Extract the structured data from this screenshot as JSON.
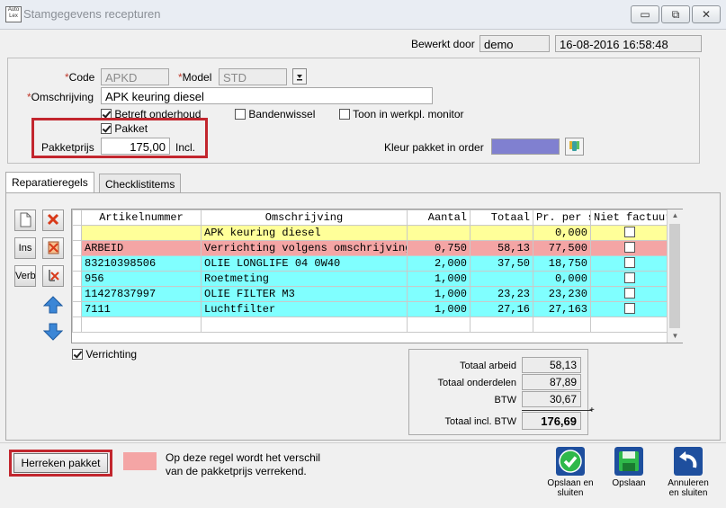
{
  "window": {
    "title": "Stamgegevens recepturen",
    "icon_text": "Auto Lex",
    "min_label": "▭",
    "restore_label": "⧉",
    "close_label": "✕"
  },
  "header": {
    "edited_by_label": "Bewerkt door",
    "edited_by_value": "demo",
    "edited_datetime": "16-08-2016 16:58:48"
  },
  "form": {
    "code_label": "Code",
    "code_value": "APKD",
    "model_label": "Model",
    "model_value": "STD",
    "description_label": "Omschrijving",
    "description_value": "APK keuring diesel",
    "betreft_onderhoud_label": "Betreft onderhoud",
    "bandenwissel_label": "Bandenwissel",
    "toon_monitor_label": "Toon in werkpl. monitor",
    "pakket_label": "Pakket",
    "pakketprijs_label": "Pakketprijs",
    "pakketprijs_value": "175,00",
    "incl_label": "Incl.",
    "kleur_label": "Kleur pakket in order",
    "kleur_color": "#8080d0"
  },
  "tabs": [
    {
      "label": "Reparatieregels"
    },
    {
      "label": "Checklistitems"
    }
  ],
  "side_buttons": {
    "ins_label": "Ins",
    "verb_label": "Verb"
  },
  "grid": {
    "columns": [
      "Artikelnummer",
      "Omschrijving",
      "Aantal",
      "Totaal",
      "Pr. per s",
      "Niet factuur"
    ],
    "rows": [
      {
        "art": "",
        "desc": "APK keuring diesel",
        "qty": "",
        "total": "",
        "price": "0,000",
        "color": "#ffff99"
      },
      {
        "art": "ARBEID",
        "desc": "Verrichting volgens omschrijving",
        "qty": "0,750",
        "total": "58,13",
        "price": "77,500",
        "color": "#f4a5a5"
      },
      {
        "art": "83210398506",
        "desc": "OLIE LONGLIFE 04 0W40",
        "qty": "2,000",
        "total": "37,50",
        "price": "18,750",
        "color": "#80ffff"
      },
      {
        "art": "956",
        "desc": "Roetmeting",
        "qty": "1,000",
        "total": "",
        "price": "0,000",
        "color": "#80ffff"
      },
      {
        "art": "11427837997",
        "desc": "OLIE FILTER M3",
        "qty": "1,000",
        "total": "23,23",
        "price": "23,230",
        "color": "#80ffff"
      },
      {
        "art": "7111",
        "desc": "Luchtfilter",
        "qty": "1,000",
        "total": "27,16",
        "price": "27,163",
        "color": "#80ffff"
      }
    ]
  },
  "verrichting_label": "Verrichting",
  "totals": {
    "arbeid_label": "Totaal arbeid",
    "arbeid_value": "58,13",
    "onderdelen_label": "Totaal onderdelen",
    "onderdelen_value": "87,89",
    "btw_label": "BTW",
    "btw_value": "30,67",
    "incl_label": "Totaal incl. BTW",
    "incl_value": "176,69"
  },
  "footer": {
    "herreken_label": "Herreken pakket",
    "legend_text_1": "Op deze regel wordt het verschil",
    "legend_text_2": "van de pakketprijs verrekend.",
    "legend_color": "#f4a5a5",
    "save_close_label_1": "Opslaan en",
    "save_close_label_2": "sluiten",
    "save_label": "Opslaan",
    "cancel_label_1": "Annuleren",
    "cancel_label_2": "en sluiten"
  }
}
